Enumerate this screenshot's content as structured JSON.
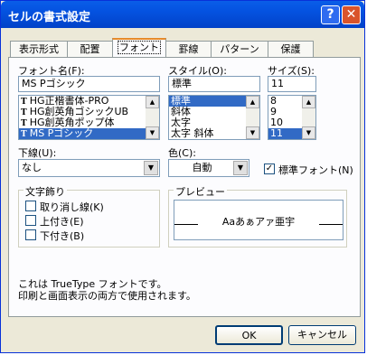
{
  "window": {
    "title": "セルの書式設定"
  },
  "titlebar_buttons": {
    "help": "?",
    "close": "✕"
  },
  "tabs": [
    "表示形式",
    "配置",
    "フォント",
    "罫線",
    "パターン",
    "保護"
  ],
  "font": {
    "label": "フォント名(F):",
    "value": "MS Pゴシック",
    "items": [
      "HG正楷書体-PRO",
      "HG創英角ゴシックUB",
      "HG創英角ポップ体",
      "MS Pゴシック"
    ],
    "selected_index": 3,
    "tt_glyph": "T"
  },
  "style": {
    "label": "スタイル(O):",
    "value": "標準",
    "items": [
      "標準",
      "斜体",
      "太字",
      "太字 斜体"
    ],
    "selected_index": 0
  },
  "size": {
    "label": "サイズ(S):",
    "value": "11",
    "items": [
      "8",
      "9",
      "10",
      "11"
    ],
    "selected_index": 3
  },
  "underline": {
    "label": "下線(U):",
    "value": "なし"
  },
  "color": {
    "label": "色(C):",
    "value": "自動"
  },
  "normal_font": {
    "label": "標準フォント(N)",
    "checked": true
  },
  "effects": {
    "title": "文字飾り",
    "items": [
      "取り消し線(K)",
      "上付き(E)",
      "下付き(B)"
    ]
  },
  "preview": {
    "title": "プレビュー",
    "sample": "Aaあぁアァ亜宇"
  },
  "info": {
    "line1": "これは TrueType フォントです。",
    "line2": "印刷と画面表示の両方で使用されます。"
  },
  "buttons": {
    "ok": "OK",
    "cancel": "キャンセル"
  },
  "glyphs": {
    "up": "▲",
    "down": "▼",
    "check": "✓"
  }
}
